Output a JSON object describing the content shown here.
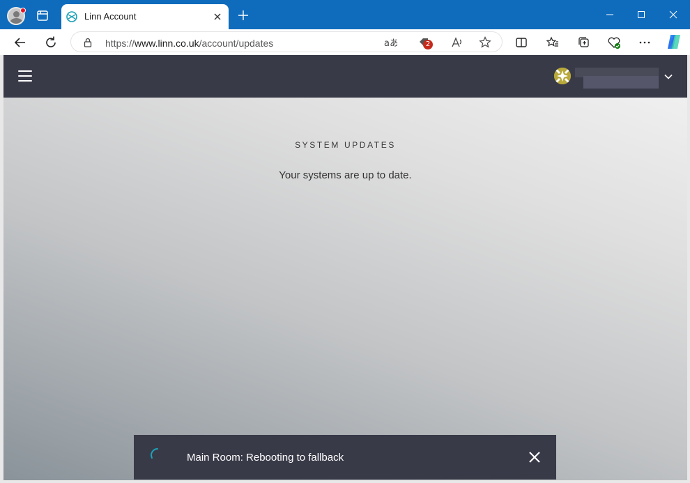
{
  "browser": {
    "tab_title": "Linn Account",
    "url_prefix": "https://",
    "url_host": "www.linn.co.uk",
    "url_path": "/account/updates",
    "extension_badge": "2",
    "icons": [
      "profile-icon",
      "tab-actions-icon",
      "linn-favicon-icon",
      "close-icon",
      "new-tab-icon",
      "minimize-icon",
      "maximize-icon",
      "window-close-icon",
      "back-icon",
      "refresh-icon",
      "lock-icon",
      "translate-icon",
      "extension-icon",
      "read-aloud-icon",
      "favorite-star-icon",
      "split-screen-icon",
      "favorites-icon",
      "collections-icon",
      "browser-essentials-icon",
      "more-icon",
      "copilot-icon"
    ],
    "accent_color": "#0f6cbd"
  },
  "app": {
    "header_color": "#393a48",
    "section_title": "SYSTEM UPDATES",
    "status_message": "Your systems are up to date."
  },
  "toast": {
    "message": "Main Room: Rebooting to fallback",
    "spinner_color": "#1ba3b8"
  }
}
